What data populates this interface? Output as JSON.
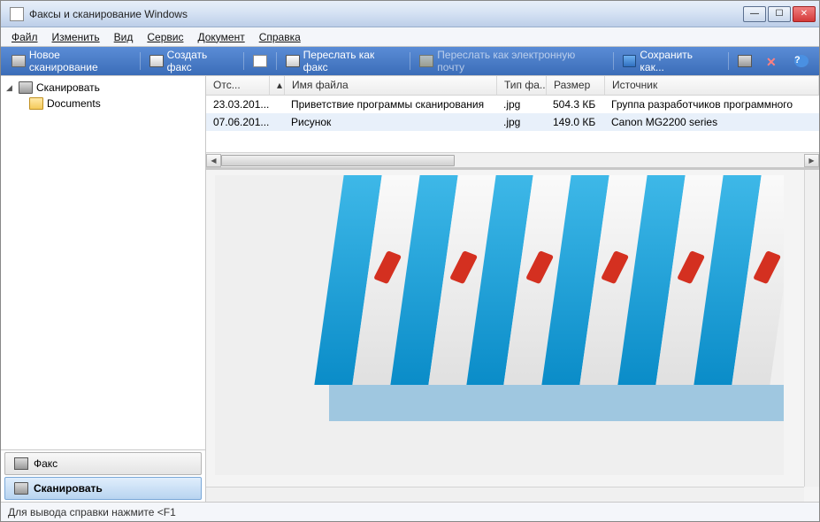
{
  "window": {
    "title": "Факсы и сканирование Windows"
  },
  "menu": {
    "file": "Файл",
    "edit": "Изменить",
    "view": "Вид",
    "service": "Сервис",
    "document": "Документ",
    "help": "Справка"
  },
  "toolbar": {
    "new_scan": "Новое сканирование",
    "create_fax": "Создать факс",
    "forward_as_fax": "Переслать как факс",
    "forward_as_email": "Переслать как электронную почту",
    "save_as": "Сохранить как..."
  },
  "sidebar": {
    "scan_node": "Сканировать",
    "documents_node": "Documents",
    "tab_fax": "Факс",
    "tab_scan": "Сканировать"
  },
  "columns": {
    "date": "Отс...",
    "name": "Имя файла",
    "type": "Тип фа...",
    "size": "Размер",
    "source": "Источник"
  },
  "rows": [
    {
      "date": "23.03.201...",
      "name": "Приветствие программы сканирования",
      "type": ".jpg",
      "size": "504.3 КБ",
      "source": "Группа разработчиков программного"
    },
    {
      "date": "07.06.201...",
      "name": "Рисунок",
      "type": ".jpg",
      "size": "149.0 КБ",
      "source": "Canon MG2200 series"
    }
  ],
  "status": {
    "help_hint": "Для вывода справки нажмите <F1"
  }
}
